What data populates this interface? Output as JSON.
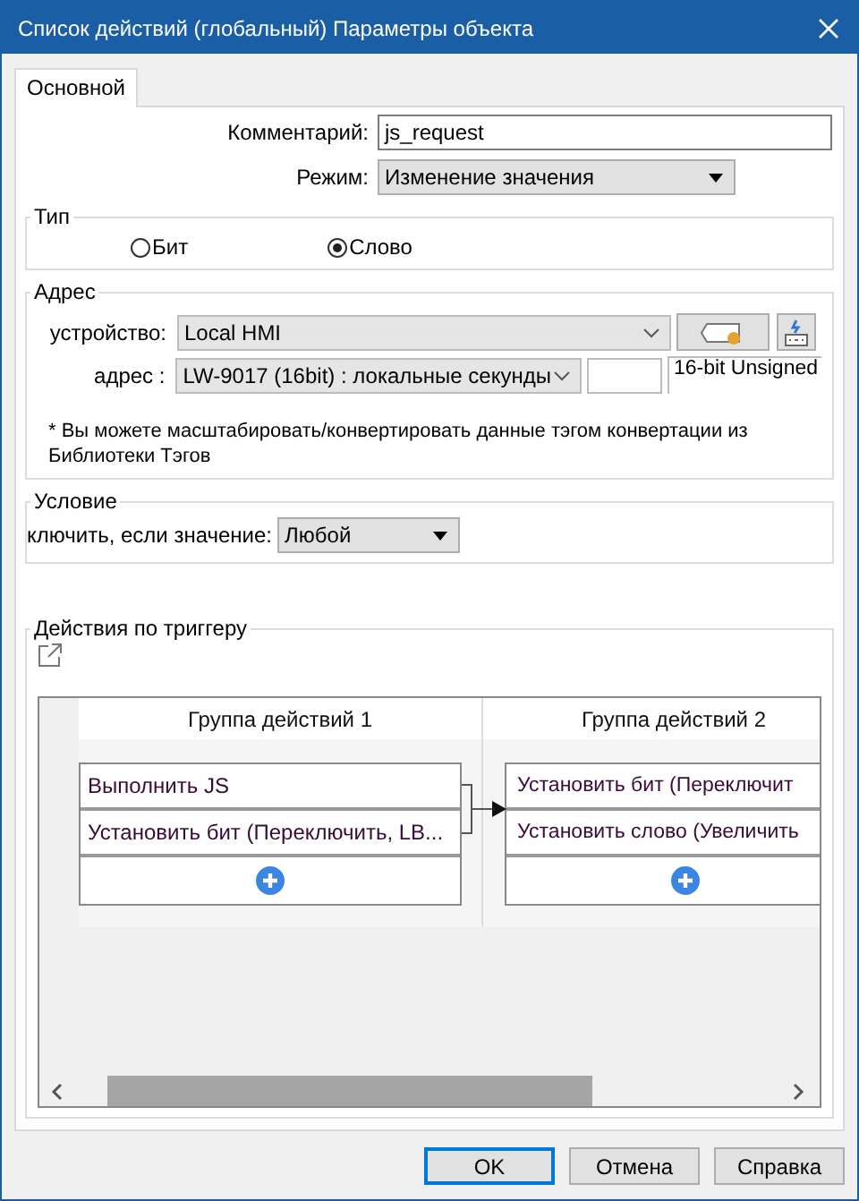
{
  "window": {
    "title": "Список действий (глобальный) Параметры объекта"
  },
  "tabs": [
    {
      "label": "Основной",
      "selected": true
    }
  ],
  "comment": {
    "label": "Комментарий:",
    "value": "js_request"
  },
  "mode": {
    "label": "Режим:",
    "value": "Изменение значения"
  },
  "type_group": {
    "title": "Тип",
    "options": [
      {
        "label": "Бит",
        "selected": false
      },
      {
        "label": "Слово",
        "selected": true
      }
    ]
  },
  "address_group": {
    "title": "Адрес",
    "device_label": "устройство:",
    "device": "Local HMI",
    "address_label": "адрес :",
    "address": "LW-9017 (16bit) : локальные секунды",
    "format": "16-bit Unsigned",
    "note": "* Вы можете масштабировать/конвертировать данные тэгом конвертации из Библиотеки Тэгов"
  },
  "condition_group": {
    "title": "Условие",
    "label": "ключить, если значение:",
    "value": "Любой"
  },
  "trigger_group": {
    "title": "Действия по триггеру",
    "groups": [
      {
        "title": "Группа действий 1",
        "actions": [
          "Выполнить JS",
          "Установить бит (Переключить, LB..."
        ]
      },
      {
        "title": "Группа действий 2",
        "actions": [
          "Установить бит (Переключит",
          "Установить слово (Увеличить"
        ]
      }
    ]
  },
  "buttons": [
    {
      "label": "OK",
      "default": true
    },
    {
      "label": "Отмена",
      "default": false
    },
    {
      "label": "Справка",
      "default": false
    }
  ]
}
